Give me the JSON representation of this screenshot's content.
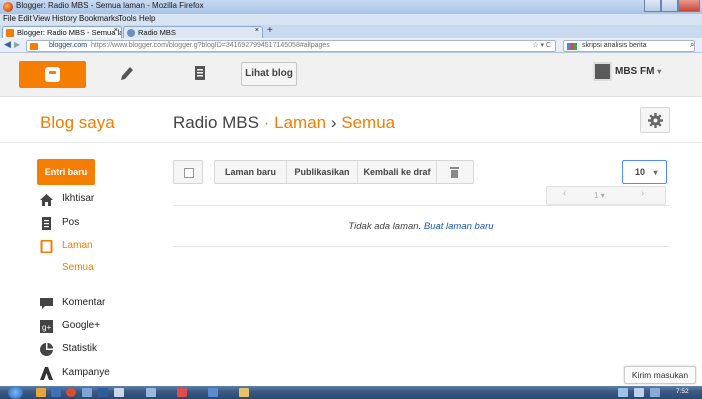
{
  "window": {
    "title": "Blogger: Radio MBS - Semua laman - Mozilla Firefox"
  },
  "menubar": {
    "items": [
      "File",
      "Edit",
      "View",
      "History",
      "Bookmarks",
      "Tools",
      "Help"
    ]
  },
  "tabs": [
    {
      "label": "Blogger: Radio MBS - Semua laman",
      "active": true
    },
    {
      "label": "Radio MBS",
      "active": false
    }
  ],
  "navbar": {
    "url_host": "blogger.com",
    "url": "https://www.blogger.com/blogger.g?blogID=3416927994517145058#allpages",
    "search_value": "skripsi analisis berita"
  },
  "top_toolbar": {
    "view_blog_label": "Lihat blog",
    "user_name": "MBS FM",
    "user_caret": "▾"
  },
  "header": {
    "blog_saya": "Blog saya",
    "blog_name": "Radio MBS",
    "sep1": "·",
    "section": "Laman",
    "sep2": "›",
    "subsection": "Semua"
  },
  "sidebar": {
    "new_post_label": "Entri baru",
    "items": [
      {
        "label": "Ikhtisar",
        "icon": "home-icon"
      },
      {
        "label": "Pos",
        "icon": "posts-icon"
      },
      {
        "label": "Laman",
        "icon": "pages-icon",
        "active": true
      },
      {
        "label": "Semua",
        "sub": true,
        "active": true
      },
      {
        "label": "Komentar",
        "icon": "comment-icon"
      },
      {
        "label": "Google+",
        "icon": "google-plus-icon"
      },
      {
        "label": "Statistik",
        "icon": "stats-icon"
      },
      {
        "label": "Kampanye",
        "icon": "campaign-icon"
      }
    ]
  },
  "content_toolbar": {
    "new_page": "Laman baru",
    "publish": "Publikasikan",
    "revert_draft": "Kembali ke draf",
    "per_page": "10",
    "per_page_caret": "▾"
  },
  "pager": {
    "prev": "‹",
    "page": "1",
    "caret": "▾",
    "next": "›"
  },
  "empty_state": {
    "message": "Tidak ada laman.",
    "link": "Buat laman baru"
  },
  "feedback_label": "Kirim masukan",
  "taskbar": {
    "clock": "7:52"
  },
  "colors": {
    "blogger_orange": "#f57d00",
    "link_blue": "#1a59c4"
  }
}
